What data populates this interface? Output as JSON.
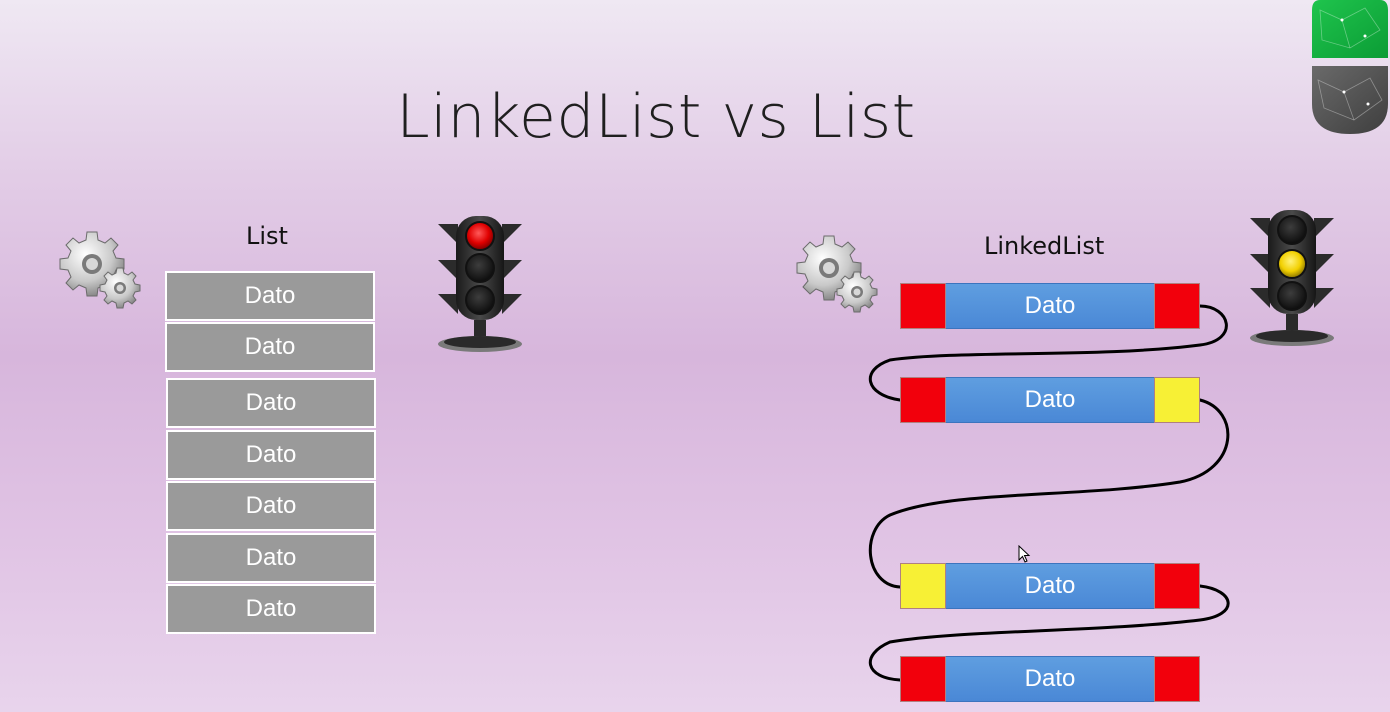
{
  "slide": {
    "title": "LinkedList vs List"
  },
  "list_section": {
    "label": "List",
    "items": [
      "Dato",
      "Dato",
      "Dato",
      "Dato",
      "Dato",
      "Dato",
      "Dato"
    ],
    "traffic_light": "red-light-icon"
  },
  "linkedlist_section": {
    "label": "LinkedList",
    "nodes": [
      {
        "label": "Dato",
        "left_pointer": "red",
        "right_pointer": "red"
      },
      {
        "label": "Dato",
        "left_pointer": "red",
        "right_pointer": "yellow"
      },
      {
        "label": "Dato",
        "left_pointer": "yellow",
        "right_pointer": "red"
      },
      {
        "label": "Dato",
        "left_pointer": "red",
        "right_pointer": "red"
      }
    ],
    "traffic_light": "yellow-light-icon"
  },
  "colors": {
    "pointer_red": "#f2000c",
    "pointer_yellow": "#f7f035",
    "node_blue": "#4a88d6",
    "list_gray": "#9a9a9a"
  }
}
